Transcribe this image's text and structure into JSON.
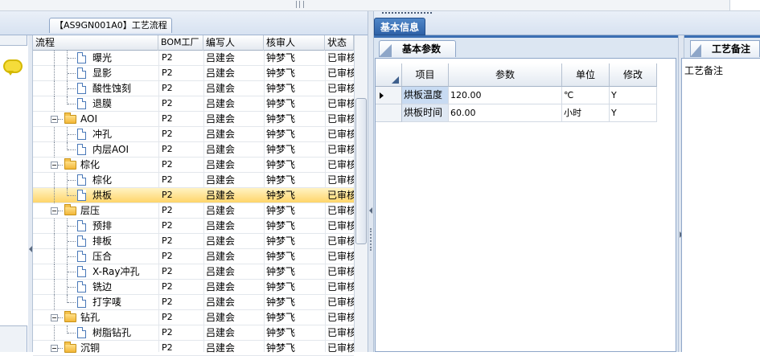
{
  "left_tab": {
    "title": "【AS9GN001A0】工艺流程"
  },
  "grid": {
    "columns": {
      "flow": "流程",
      "plant": "BOM工厂",
      "author": "编写人",
      "reviewer": "核审人",
      "status": "状态"
    },
    "rows": [
      {
        "name": "曝光",
        "type": "doc",
        "plant": "P2",
        "author": "吕建会",
        "reviewer": "钟梦飞",
        "status": "已审核"
      },
      {
        "name": "显影",
        "type": "doc",
        "plant": "P2",
        "author": "吕建会",
        "reviewer": "钟梦飞",
        "status": "已审核"
      },
      {
        "name": "酸性蚀刻",
        "type": "doc",
        "plant": "P2",
        "author": "吕建会",
        "reviewer": "钟梦飞",
        "status": "已审核"
      },
      {
        "name": "退膜",
        "type": "doc",
        "plant": "P2",
        "author": "吕建会",
        "reviewer": "钟梦飞",
        "status": "已审核"
      },
      {
        "name": "AOI",
        "type": "folder",
        "plant": "P2",
        "author": "吕建会",
        "reviewer": "钟梦飞",
        "status": "已审核"
      },
      {
        "name": "冲孔",
        "type": "doc",
        "plant": "P2",
        "author": "吕建会",
        "reviewer": "钟梦飞",
        "status": "已审核"
      },
      {
        "name": "内层AOI",
        "type": "doc",
        "plant": "P2",
        "author": "吕建会",
        "reviewer": "钟梦飞",
        "status": "已审核"
      },
      {
        "name": "棕化",
        "type": "folder",
        "plant": "P2",
        "author": "吕建会",
        "reviewer": "钟梦飞",
        "status": "已审核"
      },
      {
        "name": "棕化",
        "type": "doc",
        "plant": "P2",
        "author": "吕建会",
        "reviewer": "钟梦飞",
        "status": "已审核"
      },
      {
        "name": "烘板",
        "type": "doc",
        "selected": true,
        "plant": "P2",
        "author": "吕建会",
        "reviewer": "钟梦飞",
        "status": "已审核"
      },
      {
        "name": "层压",
        "type": "folder",
        "plant": "P2",
        "author": "吕建会",
        "reviewer": "钟梦飞",
        "status": "已审核"
      },
      {
        "name": "预排",
        "type": "doc",
        "plant": "P2",
        "author": "吕建会",
        "reviewer": "钟梦飞",
        "status": "已审核"
      },
      {
        "name": "排板",
        "type": "doc",
        "plant": "P2",
        "author": "吕建会",
        "reviewer": "钟梦飞",
        "status": "已审核"
      },
      {
        "name": "压合",
        "type": "doc",
        "plant": "P2",
        "author": "吕建会",
        "reviewer": "钟梦飞",
        "status": "已审核"
      },
      {
        "name": "X-Ray冲孔",
        "type": "doc",
        "plant": "P2",
        "author": "吕建会",
        "reviewer": "钟梦飞",
        "status": "已审核"
      },
      {
        "name": "铣边",
        "type": "doc",
        "plant": "P2",
        "author": "吕建会",
        "reviewer": "钟梦飞",
        "status": "已审核"
      },
      {
        "name": "打字唛",
        "type": "doc",
        "plant": "P2",
        "author": "吕建会",
        "reviewer": "钟梦飞",
        "status": "已审核"
      },
      {
        "name": "钻孔",
        "type": "folder",
        "plant": "P2",
        "author": "吕建会",
        "reviewer": "钟梦飞",
        "status": "已审核"
      },
      {
        "name": "树脂钻孔",
        "type": "doc",
        "plant": "P2",
        "author": "吕建会",
        "reviewer": "钟梦飞",
        "status": "已审核"
      },
      {
        "name": "沉铜",
        "type": "folder",
        "plant": "P2",
        "author": "吕建会",
        "reviewer": "钟梦飞",
        "status": "已审核"
      }
    ]
  },
  "right_tab": {
    "title": "基本信息"
  },
  "params_tab": {
    "title": "基本参数"
  },
  "params": {
    "columns": {
      "item": "项目",
      "value": "参数",
      "unit": "单位",
      "modify": "修改"
    },
    "rows": [
      {
        "item": "烘板温度",
        "value": "120.00",
        "unit": "℃",
        "modify": "Y"
      },
      {
        "item": "烘板时间",
        "value": "60.00",
        "unit": "小时",
        "modify": "Y"
      }
    ]
  },
  "notes_tab": {
    "title": "工艺备注",
    "label": "工艺备注"
  }
}
